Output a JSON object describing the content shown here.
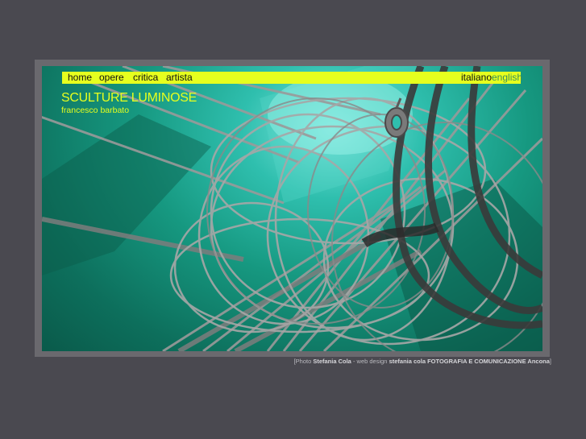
{
  "nav": {
    "items": [
      {
        "label": "home"
      },
      {
        "label": "opere"
      },
      {
        "label": "critica"
      },
      {
        "label": "artista"
      }
    ]
  },
  "lang": {
    "italiano": "italiano",
    "english": "english"
  },
  "site": {
    "title": "SCULTURE LUMINOSE",
    "subtitle": "francesco barbato"
  },
  "credits": {
    "open": "[Photo",
    "photographer": "Stefania Cola",
    "sep": "- web design",
    "designer": "stefania cola FOTOGRAFIA E COMUNICAZIONE Ancona",
    "close": "]"
  },
  "colors": {
    "background": "#4a4950",
    "accent": "#e6ff1e",
    "frame": "#6a696e",
    "photo_teal": "#169880"
  }
}
